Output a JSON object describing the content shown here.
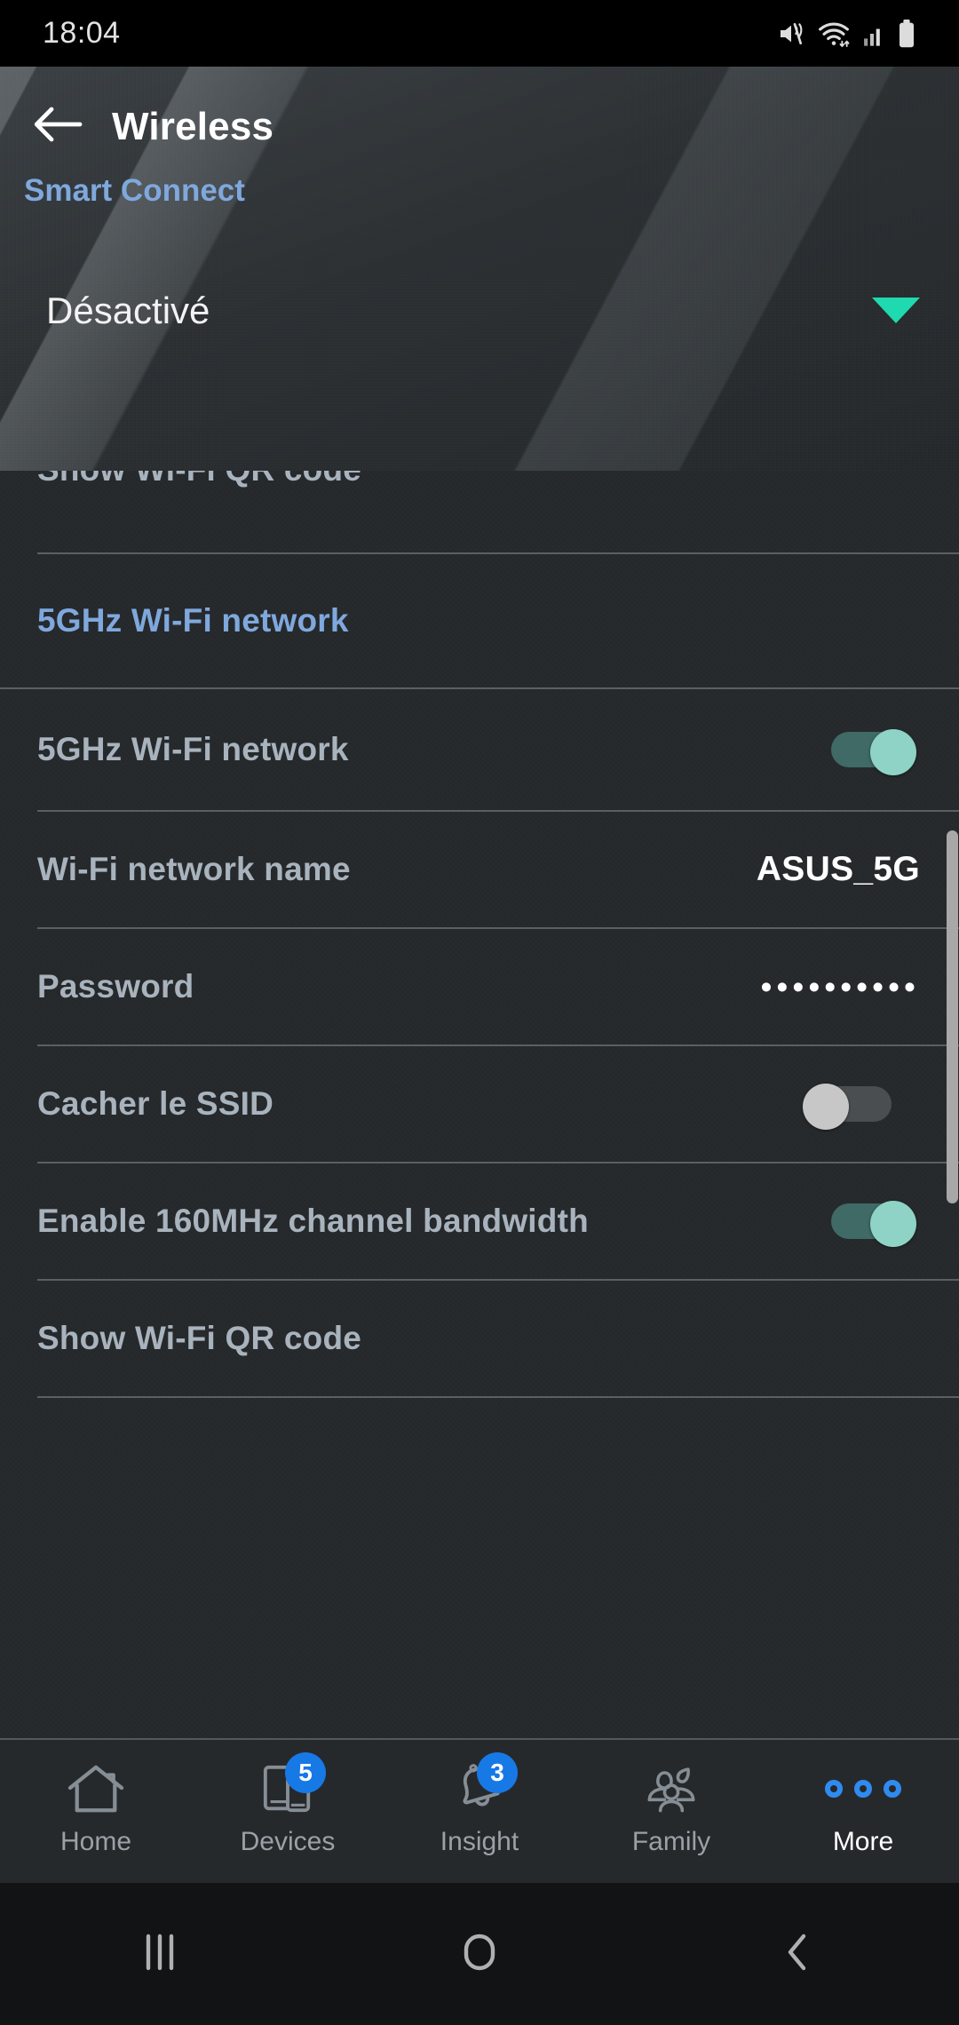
{
  "status_bar": {
    "time": "18:04",
    "icons": [
      "mute-icon",
      "wifi-icon",
      "cellular-signal-icon",
      "battery-icon"
    ]
  },
  "header": {
    "back_icon": "arrow-left-icon",
    "title": "Wireless",
    "smart_connect_label": "Smart Connect",
    "smart_connect_value": "Désactivé",
    "caret_icon": "chevron-down-icon",
    "caret_color": "#1fd9b0"
  },
  "list": {
    "clipped_row_label": "Show Wi-Fi QR code",
    "section_header": "5GHz Wi-Fi network",
    "rows": [
      {
        "label": "5GHz Wi-Fi network",
        "type": "toggle",
        "state": "on"
      },
      {
        "label": "Wi-Fi network name",
        "type": "value",
        "value": "ASUS_5G"
      },
      {
        "label": "Password",
        "type": "password",
        "value": "••••••••••"
      },
      {
        "label": "Cacher le SSID",
        "type": "toggle",
        "state": "off"
      },
      {
        "label": "Enable 160MHz channel bandwidth",
        "type": "toggle",
        "state": "on"
      },
      {
        "label": "Show Wi-Fi QR code",
        "type": "plain"
      }
    ]
  },
  "bottom_nav": {
    "items": [
      {
        "label": "Home",
        "icon": "house-icon",
        "badge": "",
        "active": false
      },
      {
        "label": "Devices",
        "icon": "devices-icon",
        "badge": "5",
        "active": false
      },
      {
        "label": "Insight",
        "icon": "bell-icon",
        "badge": "3",
        "active": false
      },
      {
        "label": "Family",
        "icon": "family-group-icon",
        "badge": "",
        "active": false
      },
      {
        "label": "More",
        "icon": "more-dots-icon",
        "badge": "",
        "active": true
      }
    ],
    "badge_color": "#1779e6",
    "active_color": "#2f8bf0"
  },
  "system_nav": {
    "recents": "recents-icon",
    "home": "home-circle-icon",
    "back": "back-chevron-icon"
  },
  "colors": {
    "accent_blue": "#7fa8dd",
    "toggle_on": "#8ed3c6",
    "teal": "#1fd9b0",
    "list_bg": "#26292c"
  }
}
